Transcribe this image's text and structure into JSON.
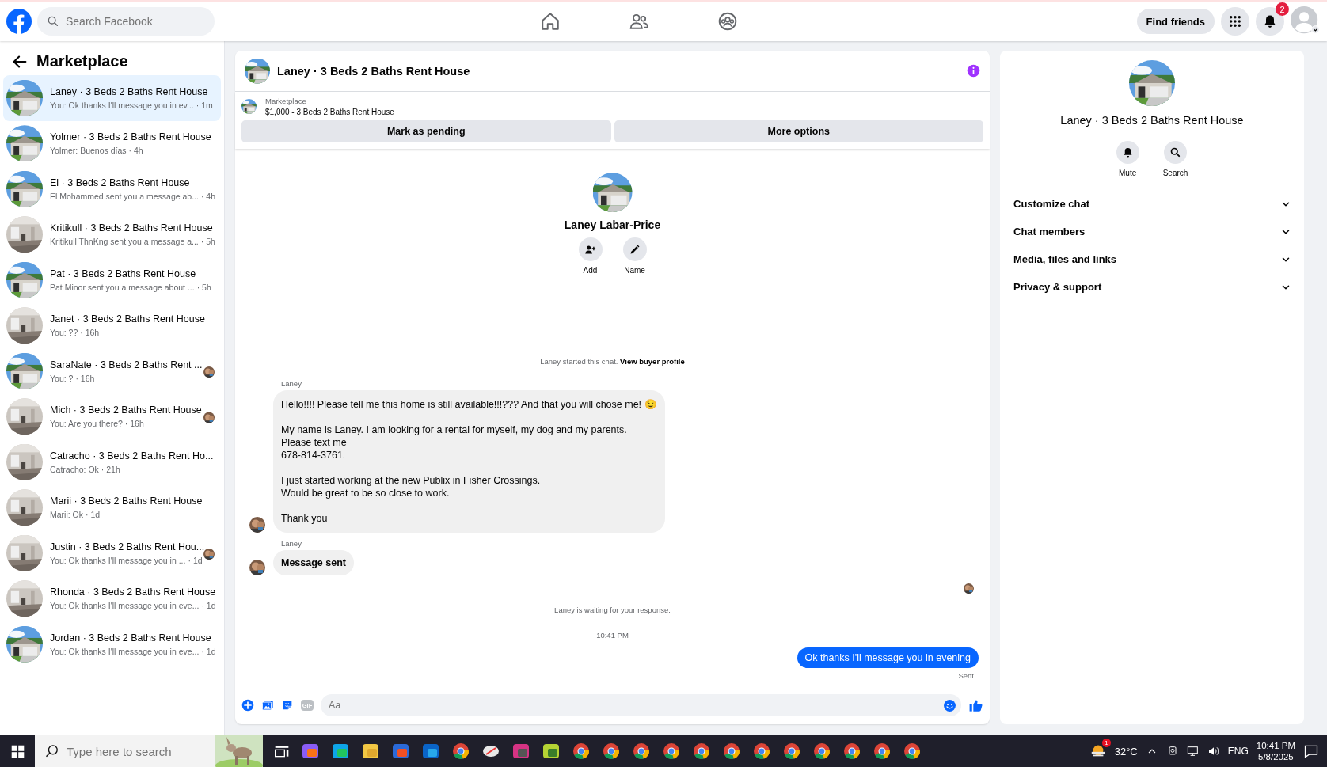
{
  "topbar": {
    "search": {
      "placeholder": "Search Facebook"
    },
    "find_friends": "Find friends",
    "notification_count": "2"
  },
  "sidebar": {
    "title": "Marketplace",
    "conversations": [
      {
        "title": "Laney · 3 Beds 2 Baths Rent House",
        "preview": "You: Ok thanks I'll message you in ev...",
        "time": "· 1m",
        "selected": true,
        "seen": false
      },
      {
        "title": "Yolmer · 3 Beds 2 Baths Rent House",
        "preview": "Yolmer: Buenos días",
        "time": "· 4h",
        "selected": false,
        "seen": false
      },
      {
        "title": "El · 3 Beds 2 Baths Rent House",
        "preview": "El Mohammed sent you a message ab...",
        "time": "· 4h",
        "selected": false,
        "seen": false
      },
      {
        "title": "Kritikull · 3 Beds 2 Baths Rent House",
        "preview": "Kritikull ThnKng sent you a message a...",
        "time": "· 5h",
        "selected": false,
        "seen": false
      },
      {
        "title": "Pat · 3 Beds 2 Baths Rent House",
        "preview": "Pat Minor sent you a message about ...",
        "time": "· 5h",
        "selected": false,
        "seen": false
      },
      {
        "title": "Janet · 3 Beds 2 Baths Rent House",
        "preview": "You: ??",
        "time": "· 16h",
        "selected": false,
        "seen": false
      },
      {
        "title": "SaraNate · 3 Beds 2 Baths Rent ...",
        "preview": "You: ?",
        "time": "· 16h",
        "selected": false,
        "seen": true
      },
      {
        "title": "Mich · 3 Beds 2 Baths Rent House",
        "preview": "You: Are you there?",
        "time": "· 16h",
        "selected": false,
        "seen": true
      },
      {
        "title": "Catracho · 3 Beds 2 Baths Rent Ho...",
        "preview": "Catracho: Ok",
        "time": "· 21h",
        "selected": false,
        "seen": false
      },
      {
        "title": "Marii · 3 Beds 2 Baths Rent House",
        "preview": "Marii: Ok",
        "time": "· 1d",
        "selected": false,
        "seen": false
      },
      {
        "title": "Justin · 3 Beds 2 Baths Rent Hou...",
        "preview": "You: Ok thanks I'll message you in ...",
        "time": "· 1d",
        "selected": false,
        "seen": true
      },
      {
        "title": "Rhonda · 3 Beds 2 Baths Rent House",
        "preview": "You: Ok thanks I'll message you in eve...",
        "time": "· 1d",
        "selected": false,
        "seen": false
      },
      {
        "title": "Jordan · 3 Beds 2 Baths Rent House",
        "preview": "You: Ok thanks I'll message you in eve...",
        "time": "· 1d",
        "selected": false,
        "seen": false
      }
    ]
  },
  "chat": {
    "title": "Laney · 3 Beds 2 Baths Rent House",
    "listing": {
      "label": "Marketplace",
      "title": "$1,000 - 3 Beds 2 Baths Rent House"
    },
    "actions": [
      "Mark as pending",
      "More options"
    ],
    "profile": {
      "name": "Laney Labar-Price",
      "actions": [
        {
          "kind": "add",
          "label": "Add"
        },
        {
          "kind": "name",
          "label": "Name"
        }
      ]
    },
    "messages": [
      {
        "kind": "notice",
        "text": "Laney started this chat.",
        "link": "View buyer profile"
      },
      {
        "kind": "incoming",
        "sender": "Laney",
        "text": "Hello!!!! Please tell me this home is still available!!!??? And that you will chose me! 😉\n\nMy name is Laney. I am looking for a rental for myself, my dog and my parents.\nPlease text me\n678-814-3761.\n\nI just started working at the new Publix in Fisher Crossings.\nWould be great to be so close to work.\n\nThank you",
        "emphasis": false
      },
      {
        "kind": "incoming",
        "sender": "Laney",
        "text": "Message sent",
        "emphasis": true
      },
      {
        "kind": "read_receipt"
      },
      {
        "kind": "notice",
        "text": "Laney is waiting for your response."
      },
      {
        "kind": "timestamp",
        "text": "10:41 PM"
      },
      {
        "kind": "outgoing",
        "text": "Ok thanks I'll message you in evening",
        "status": "Sent"
      }
    ],
    "composer": {
      "placeholder": "Aa",
      "gif": "GIF"
    }
  },
  "details": {
    "title": "Laney · 3 Beds 2 Baths Rent House",
    "actions": [
      {
        "kind": "mute",
        "label": "Mute"
      },
      {
        "kind": "search",
        "label": "Search"
      }
    ],
    "sections": [
      {
        "label": "Customize chat",
        "expanded": false
      },
      {
        "label": "Chat members",
        "expanded": false
      },
      {
        "label": "Media, files and links",
        "expanded": false
      },
      {
        "label": "Privacy & support",
        "expanded": false
      }
    ]
  },
  "taskbar": {
    "search": {
      "placeholder": "Type here to search"
    },
    "weather_badge": "1",
    "temperature": "32°C",
    "language": "ENG",
    "time": "10:41 PM",
    "date": "5/8/2025"
  }
}
